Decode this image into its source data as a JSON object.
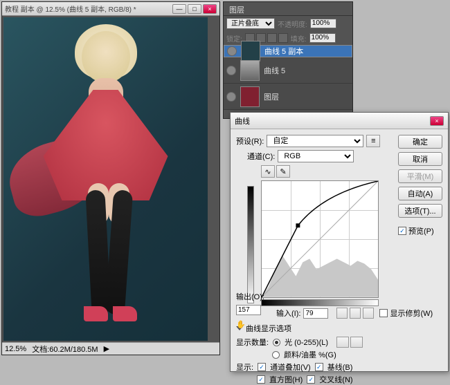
{
  "doc": {
    "title": "教程 副本 @ 12.5% (曲线 5 副本, RGB/8) *",
    "zoom": "12.5%",
    "filesize": "文档:60.2M/180.5M"
  },
  "layers": {
    "tab": "图层",
    "blend_mode": "正片叠底",
    "opacity_label": "不透明度:",
    "opacity": "100%",
    "lock_label": "锁定:",
    "fill_label": "填充:",
    "fill": "100%",
    "items": [
      {
        "name": "曲线 5 副本"
      },
      {
        "name": "曲线 5"
      },
      {
        "name": "图层"
      }
    ]
  },
  "curves": {
    "title": "曲线",
    "preset_label": "预设(R):",
    "preset_value": "自定",
    "channel_label": "通道(C):",
    "channel_value": "RGB",
    "output_label": "输出(O):",
    "output_value": "157",
    "input_label": "输入(I):",
    "input_value": "79",
    "show_clip": "显示修剪(W)",
    "expand_label": "曲线显示选项",
    "amount_label": "显示数量:",
    "light_opt": "光 (0-255)(L)",
    "pigment_opt": "颜料/油墨 %(G)",
    "show_label": "显示:",
    "overlay": "通道叠加(V)",
    "baseline": "基线(B)",
    "histogram": "直方图(H)",
    "intersection": "交叉线(N)",
    "buttons": {
      "ok": "确定",
      "cancel": "取消",
      "smooth": "平滑(M)",
      "auto": "自动(A)",
      "options": "选项(T)...",
      "preview": "预览(P)"
    }
  },
  "chart_data": {
    "type": "line",
    "title": "Curves",
    "xlabel": "Input",
    "ylabel": "Output",
    "xlim": [
      0,
      255
    ],
    "ylim": [
      0,
      255
    ],
    "series": [
      {
        "name": "curve",
        "x": [
          0,
          40,
          79,
          128,
          180,
          220,
          255
        ],
        "y": [
          0,
          90,
          157,
          205,
          232,
          248,
          255
        ]
      },
      {
        "name": "baseline",
        "x": [
          0,
          255
        ],
        "y": [
          0,
          255
        ]
      }
    ],
    "control_point": {
      "input": 79,
      "output": 157
    },
    "histogram_peaks_x": [
      30,
      60,
      100,
      140,
      180,
      210,
      240
    ]
  }
}
